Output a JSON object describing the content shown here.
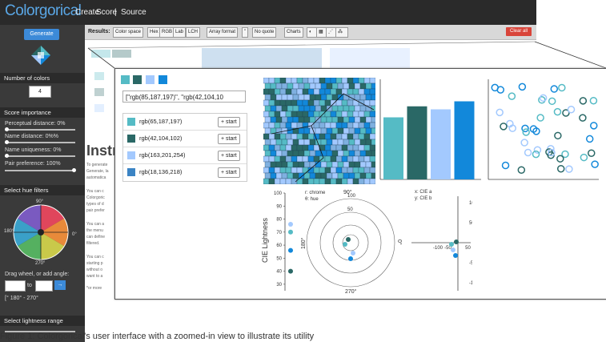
{
  "app": {
    "title": "Colorgorical"
  },
  "topnav": {
    "create": "Create",
    "score": "Score",
    "separator": "|",
    "source": "Source"
  },
  "sidebar": {
    "generate_label": "Generate",
    "num_colors_heading": "Number of colors",
    "num_colors_value": "4",
    "score_heading": "Score importance",
    "perceptual": "Perceptual distance: 0%",
    "name_distance": "Name distance: 0%%",
    "name_uniqueness": "Name uniqueness: 0%",
    "pair_preference": "Pair preference: 100%",
    "hue_heading": "Select hue filters",
    "hue_labels": {
      "top": "90°",
      "bottom": "270°",
      "left": "180°",
      "right": "0°"
    },
    "drag_hint": "Drag wheel, or add angle:",
    "angle_to": "to",
    "angle_go": "→",
    "angle_range": "[° 180° - 270°",
    "lightness_heading": "Select lightness range"
  },
  "resultsbar": {
    "results": "Results:",
    "colorspace": "Color space",
    "cs_options": [
      "Hex",
      "RGB",
      "Lab",
      "LCH"
    ],
    "array_format": "Array format",
    "quote_opt": "\"",
    "noquote_opt": "No quote",
    "charts": "Charts",
    "clear": "Clear all"
  },
  "background": {
    "title": "Instr",
    "text_lines": [
      "To generate",
      "Generate, la",
      "automatica",
      "You can c",
      "Colorgoric",
      "types of d",
      "pair prefer",
      "You can a",
      "the menu",
      "can define",
      "filtered.",
      "You can c",
      "starting p",
      "without o",
      "want to a",
      "*or more"
    ]
  },
  "palette": {
    "colors": [
      "#55bbc5",
      "#2a6866",
      "#a3c9fe",
      "#1288da"
    ],
    "code": "[\"rgb(85,187,197)\", \"rgb(42,104,10",
    "entries": [
      {
        "color": "#55bbc5",
        "label": "rgb(65,187,197)",
        "action": "+ start"
      },
      {
        "color": "#2a6866",
        "label": "rgb(42,104,102)",
        "action": "+ start"
      },
      {
        "color": "#a3c9fe",
        "label": "rgb(163,201,254)",
        "action": "+ start"
      },
      {
        "color": "#3b84c4",
        "label": "rgb(18,136,218)",
        "action": "+ start"
      }
    ]
  },
  "chart_data": [
    {
      "type": "bar",
      "categories": [
        "1",
        "2",
        "3",
        "4"
      ],
      "values": [
        62,
        73,
        70,
        78
      ],
      "ylim": [
        0,
        100
      ]
    },
    {
      "type": "scatter",
      "title": "",
      "series": []
    },
    {
      "type": "scatter",
      "ylabel": "CIE Lightness",
      "yticks": [
        100,
        90,
        80,
        70,
        60,
        50,
        40,
        30
      ],
      "ylim": [
        25,
        100
      ],
      "values": [
        76,
        70,
        56,
        40
      ]
    },
    {
      "type": "scatter",
      "legend": [
        "r: chrome",
        "θ: hue"
      ],
      "radial_ticks": [
        100,
        50
      ],
      "angle_labels": [
        "90°",
        "180°",
        "270°",
        "0°"
      ]
    },
    {
      "type": "scatter",
      "legend": [
        "x: CIE a",
        "y: CIE b"
      ],
      "xticks": [
        -100,
        -50,
        50,
        100
      ],
      "yticks": [
        100,
        50,
        -50,
        -100
      ]
    }
  ],
  "caption": "Figure 1: Colorgorical's user interface with a zoomed-in view to illustrate its utility"
}
